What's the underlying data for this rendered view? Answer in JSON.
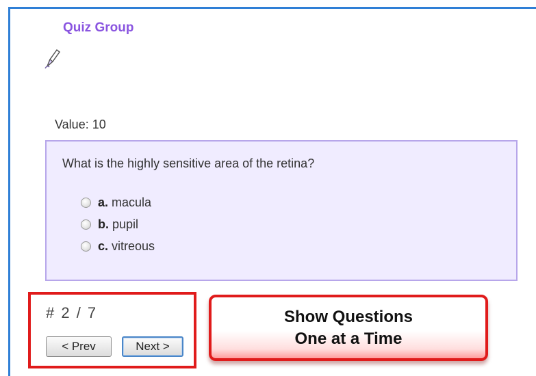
{
  "quiz": {
    "title": "Quiz Group",
    "value_label": "Value: 10"
  },
  "question": {
    "text": "What is the highly sensitive area of the retina?",
    "options": [
      {
        "letter": "a.",
        "text": "macula"
      },
      {
        "letter": "b.",
        "text": "pupil"
      },
      {
        "letter": "c.",
        "text": "vitreous"
      }
    ]
  },
  "navigation": {
    "counter": "# 2 / 7",
    "prev_label": "< Prev",
    "next_label": "Next >"
  },
  "callout": {
    "line1": "Show Questions",
    "line2": "One at a Time"
  },
  "colors": {
    "frame_border": "#2f7fd6",
    "title": "#8a55e0",
    "question_bg": "#f0ecff",
    "question_border": "#b7a6ea",
    "highlight_red": "#e01b1b"
  },
  "icons": {
    "edit": "pencil-edit-icon"
  }
}
